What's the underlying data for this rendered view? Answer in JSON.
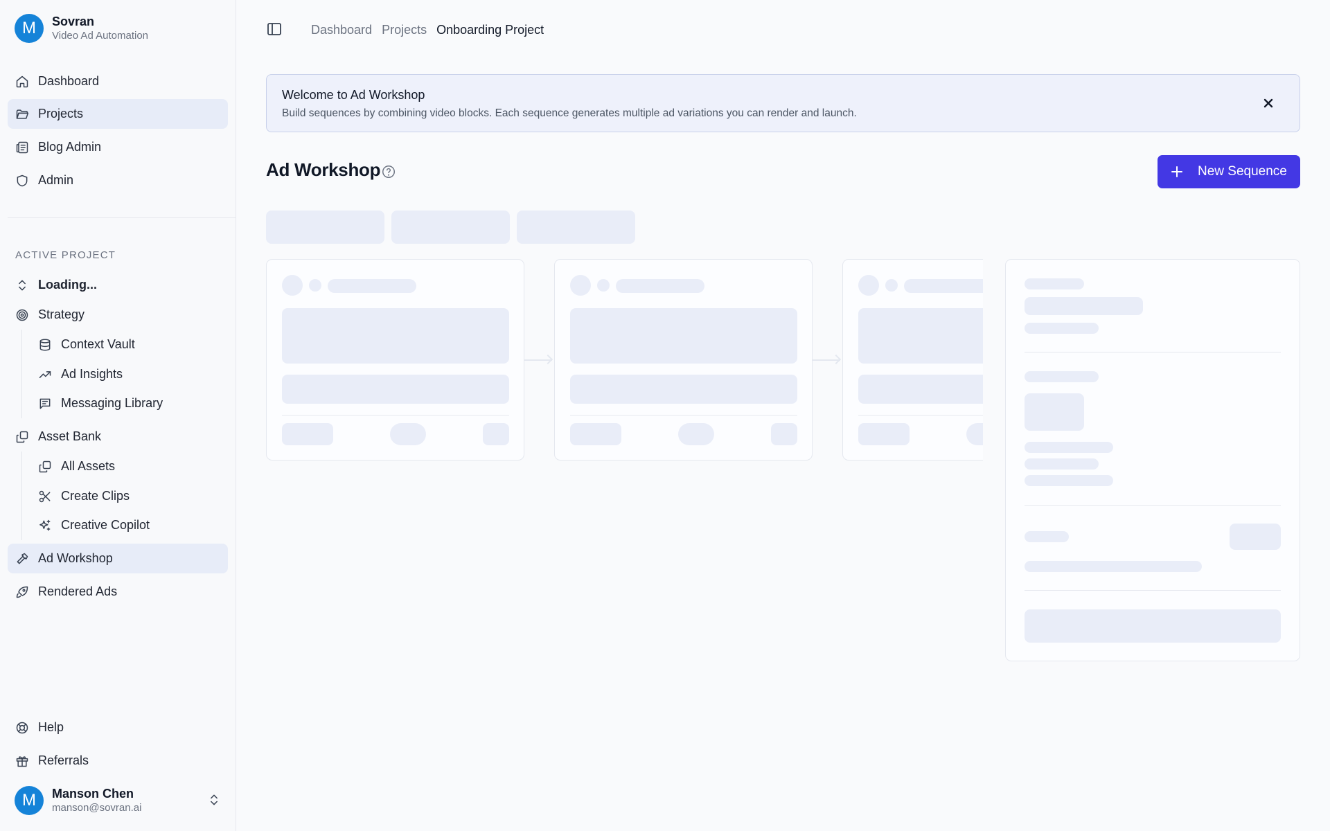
{
  "brand": {
    "initial": "M",
    "name": "Sovran",
    "subtitle": "Video Ad Automation"
  },
  "nav": {
    "dashboard": "Dashboard",
    "projects": "Projects",
    "blog_admin": "Blog Admin",
    "admin": "Admin"
  },
  "active_project": {
    "section_label": "ACTIVE PROJECT",
    "selector": "Loading...",
    "strategy": "Strategy",
    "context_vault": "Context Vault",
    "ad_insights": "Ad Insights",
    "messaging_library": "Messaging Library",
    "asset_bank": "Asset Bank",
    "all_assets": "All Assets",
    "create_clips": "Create Clips",
    "creative_copilot": "Creative Copilot",
    "ad_workshop": "Ad Workshop",
    "rendered_ads": "Rendered Ads"
  },
  "footer_nav": {
    "help": "Help",
    "referrals": "Referrals"
  },
  "user": {
    "initial": "M",
    "name": "Manson Chen",
    "email": "manson@sovran.ai"
  },
  "breadcrumb": [
    "Dashboard",
    "Projects",
    "Onboarding Project"
  ],
  "banner": {
    "title": "Welcome to Ad Workshop",
    "text": "Build sequences by combining video blocks. Each sequence generates multiple ad variations you can render and launch."
  },
  "page": {
    "title": "Ad Workshop",
    "new_sequence_label": "New Sequence"
  },
  "colors": {
    "accent": "#4338e4",
    "avatar": "#1583d8",
    "active_nav": "#e7ecf8",
    "skeleton": "#e9edf8"
  },
  "icons": {
    "dashboard": "home-icon",
    "projects": "folder-icon",
    "blog_admin": "newspaper-icon",
    "admin": "shield-icon",
    "selector": "chevrons-up-down-icon",
    "strategy": "target-icon",
    "context_vault": "database-icon",
    "ad_insights": "trending-up-icon",
    "messaging_library": "message-square-icon",
    "asset_bank": "copy-icon",
    "all_assets": "copy-icon",
    "create_clips": "scissors-icon",
    "creative_copilot": "sparkles-icon",
    "ad_workshop": "hammer-icon",
    "rendered_ads": "rocket-icon",
    "help": "life-buoy-icon",
    "referrals": "gift-icon"
  }
}
